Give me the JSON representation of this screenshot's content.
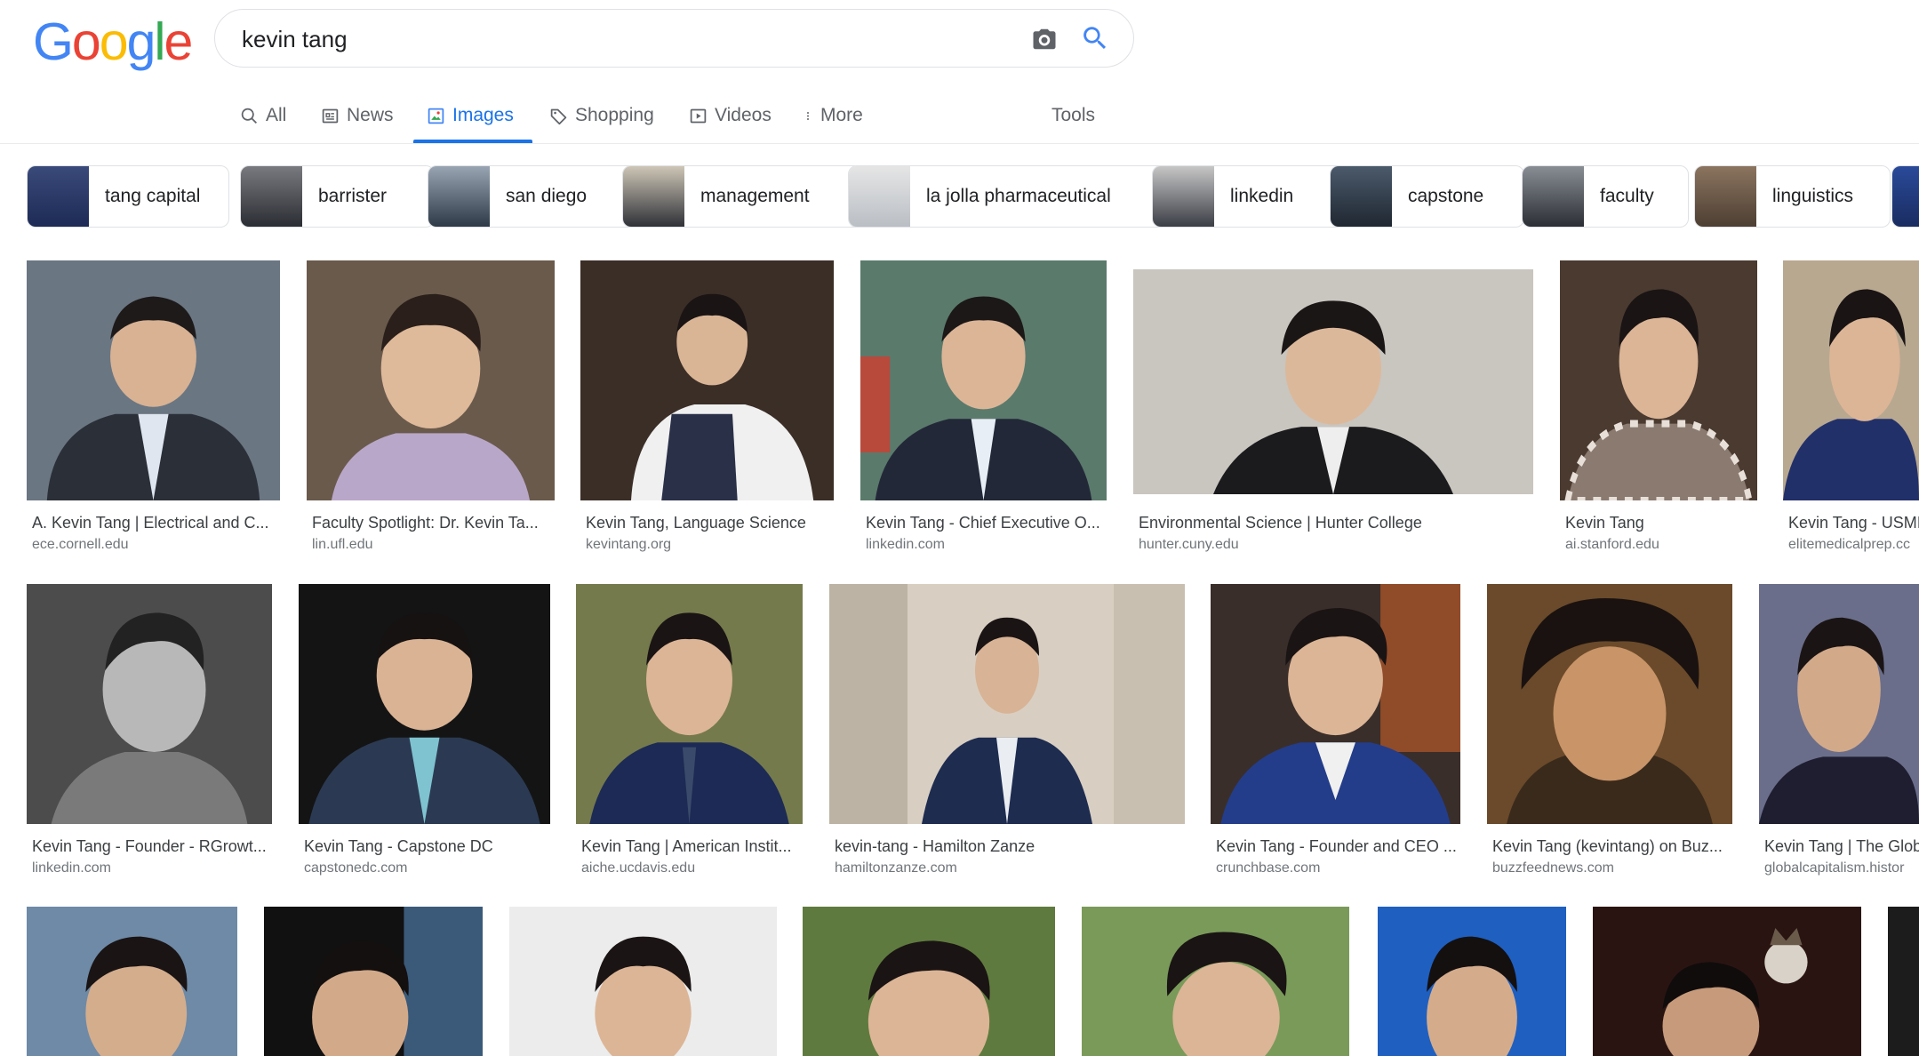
{
  "logo": "Google",
  "search": {
    "query": "kevin tang"
  },
  "tabs": [
    {
      "label": "All",
      "icon": "search-icon"
    },
    {
      "label": "News",
      "icon": "news-icon"
    },
    {
      "label": "Images",
      "icon": "image-icon",
      "active": true
    },
    {
      "label": "Shopping",
      "icon": "tag-icon"
    },
    {
      "label": "Videos",
      "icon": "play-icon"
    },
    {
      "label": "More",
      "icon": "more-vert-icon"
    },
    {
      "label": "Tools"
    }
  ],
  "chips": [
    "tang capital",
    "barrister",
    "san diego",
    "management",
    "la jolla pharmaceutical",
    "linkedin",
    "capstone",
    "faculty",
    "linguistics"
  ],
  "results": {
    "row1": [
      {
        "title": "A. Kevin Tang | Electrical and C...",
        "source": "ece.cornell.edu"
      },
      {
        "title": "Faculty Spotlight: Dr. Kevin Ta...",
        "source": "lin.ufl.edu"
      },
      {
        "title": "Kevin Tang, Language Science",
        "source": "kevintang.org"
      },
      {
        "title": "Kevin Tang - Chief Executive O...",
        "source": "linkedin.com"
      },
      {
        "title": "Environmental Science | Hunter College",
        "source": "hunter.cuny.edu"
      },
      {
        "title": "Kevin Tang",
        "source": "ai.stanford.edu"
      },
      {
        "title": "Kevin Tang - USMI",
        "source": "elitemedicalprep.cc"
      }
    ],
    "row2": [
      {
        "title": "Kevin Tang - Founder - RGrowt...",
        "source": "linkedin.com"
      },
      {
        "title": "Kevin Tang - Capstone DC",
        "source": "capstonedc.com"
      },
      {
        "title": "Kevin Tang | American Instit...",
        "source": "aiche.ucdavis.edu"
      },
      {
        "title": "kevin-tang - Hamilton Zanze",
        "source": "hamiltonzanze.com"
      },
      {
        "title": "Kevin Tang - Founder and CEO ...",
        "source": "crunchbase.com"
      },
      {
        "title": "Kevin Tang (kevintang) on Buz...",
        "source": "buzzfeednews.com"
      },
      {
        "title": "Kevin Tang | The Glob",
        "source": "globalcapitalism.histor"
      }
    ]
  },
  "colors": {
    "accent": "#1a73e8",
    "text": "#202124",
    "muted": "#70757a"
  }
}
